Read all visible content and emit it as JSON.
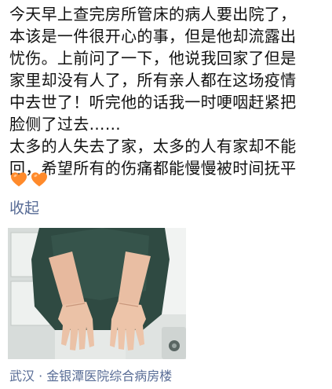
{
  "post": {
    "lines": [
      "今天早上查完房所管床的病人要出院了，",
      "本该是一件很开心的事，但是他却流露出",
      "忧伤。上前问了一下，他说我回家了但是",
      "家里却没有人了，所有亲人都在这场疫情",
      "中去世了！听完他的话我一时哽咽赶紧把",
      "脸侧了过去……",
      "太多的人失去了家，太多的人有家却不能",
      "回，希望所有的伤痛都能慢慢被时间抚平"
    ],
    "emojis": [
      "orange-heart-icon",
      "orange-heart-icon"
    ],
    "collapse_label": "收起",
    "location": "武汉 · 金银潭医院综合病房楼"
  },
  "colors": {
    "link": "#576b95",
    "heart": "#ff8a2b",
    "text": "#111111"
  }
}
